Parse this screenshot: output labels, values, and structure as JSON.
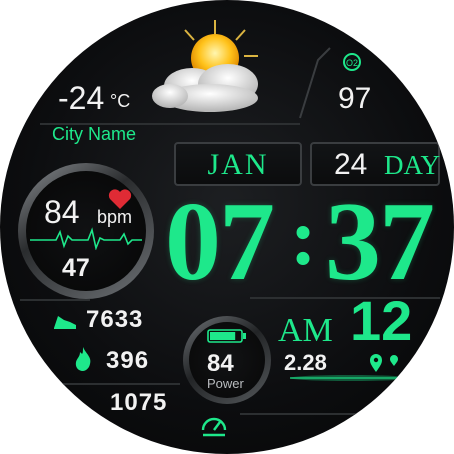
{
  "weather": {
    "temperature": "-24",
    "unit": "°C",
    "city": "City Name",
    "icon": "sun-behind-cloud-icon"
  },
  "oxygen": {
    "value": "97",
    "icon": "o2-icon"
  },
  "date": {
    "month": "JAN",
    "day_number": "24",
    "day_label": "DAY"
  },
  "heart": {
    "bpm_value": "84",
    "bpm_unit": "bpm",
    "secondary_value": "47",
    "icon": "heart-icon"
  },
  "time": {
    "hours": "07",
    "separator": ":",
    "minutes": "37",
    "ampm": "AM",
    "seconds": "12"
  },
  "stats": {
    "steps": "7633",
    "calories": "396",
    "third": "1075"
  },
  "battery": {
    "value": "84",
    "label": "Power",
    "level": 0.84
  },
  "distance": {
    "value": "2.28"
  },
  "colors": {
    "accent": "#1ee88b",
    "text": "#f2f2f2",
    "heart": "#e02b35"
  }
}
